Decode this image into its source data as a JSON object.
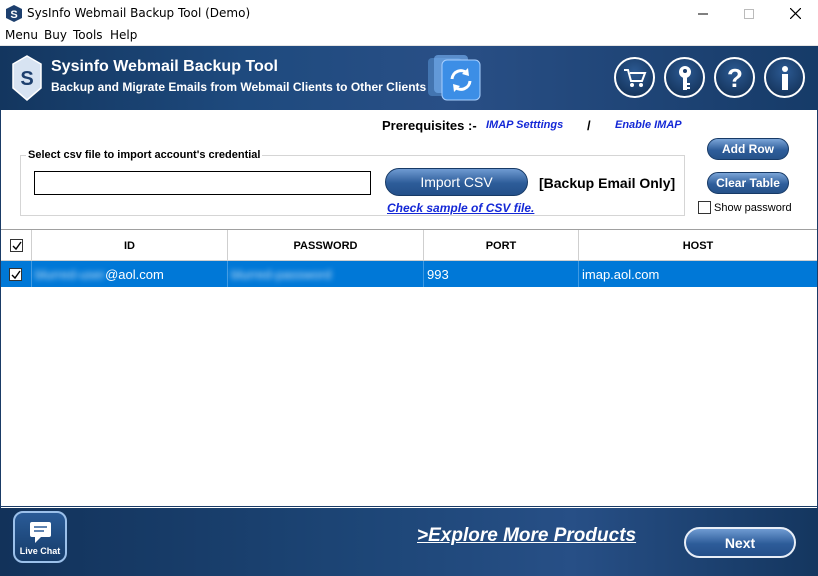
{
  "window": {
    "title": "SysInfo Webmail Backup Tool (Demo)"
  },
  "menu": [
    "Menu",
    "Buy",
    "Tools",
    "Help"
  ],
  "banner": {
    "title": "Sysinfo Webmail Backup Tool",
    "subtitle": "Backup and Migrate Emails from Webmail Clients to Other Clients",
    "icons": [
      "cart-icon",
      "key-icon",
      "help-icon",
      "info-icon"
    ]
  },
  "prerequisites": {
    "label": "Prerequisites :-",
    "imap_settings": "IMAP Setttings",
    "separator": "/",
    "enable_imap": "Enable IMAP"
  },
  "csv": {
    "legend": "Select csv file to import account's credential",
    "path_value": "",
    "import_label": "Import CSV",
    "backup_note": "[Backup Email Only]",
    "sample_link": "Check sample of CSV file."
  },
  "actions": {
    "add_row": "Add Row",
    "clear_table": "Clear Table",
    "show_password": "Show password",
    "show_password_checked": false
  },
  "table": {
    "headers": [
      "ID",
      "PASSWORD",
      "PORT",
      "HOST"
    ],
    "rows": [
      {
        "checked": true,
        "id_masked": "blurred-user",
        "id_domain": "@aol.com",
        "password_masked": "blurred-password",
        "port": "993",
        "host": "imap.aol.com"
      }
    ]
  },
  "footer": {
    "live_chat": "Live Chat",
    "explore": ">Explore More Products",
    "next": "Next"
  },
  "colors": {
    "banner": "#1e4a7e",
    "selection": "#0078d7",
    "link": "#1428d6"
  }
}
